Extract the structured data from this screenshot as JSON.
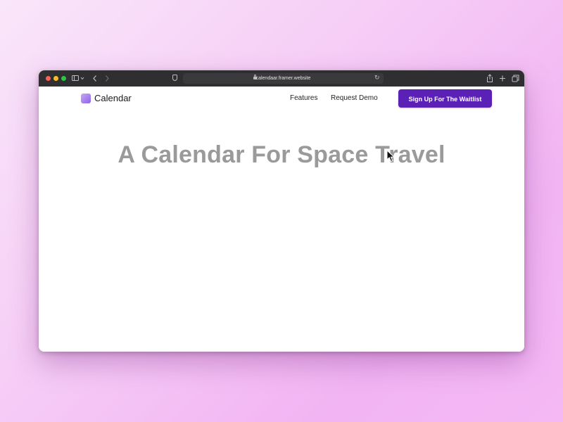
{
  "browser": {
    "url": "calendaar.framer.website",
    "icons": {
      "sidebar": "sidebar-icon",
      "back": "chevron-left-icon",
      "forward": "chevron-right-icon",
      "privacy": "shield-icon",
      "reload": "reload-icon",
      "share": "share-icon",
      "new_tab": "plus-icon",
      "tabs": "tabs-overview-icon"
    },
    "colors": {
      "close": "#ff5f57",
      "minimize": "#febc2e",
      "zoom": "#28c840",
      "chrome": "#2f2f31"
    }
  },
  "site": {
    "brand": "Calendar",
    "nav": {
      "features": "Features",
      "request_demo": "Request Demo"
    },
    "cta_label": "Sign Up For The Waitlist",
    "hero_title": "A Calendar For Space Travel",
    "colors": {
      "accent": "#5b21b6",
      "hero_text": "#9a9a9a"
    }
  }
}
